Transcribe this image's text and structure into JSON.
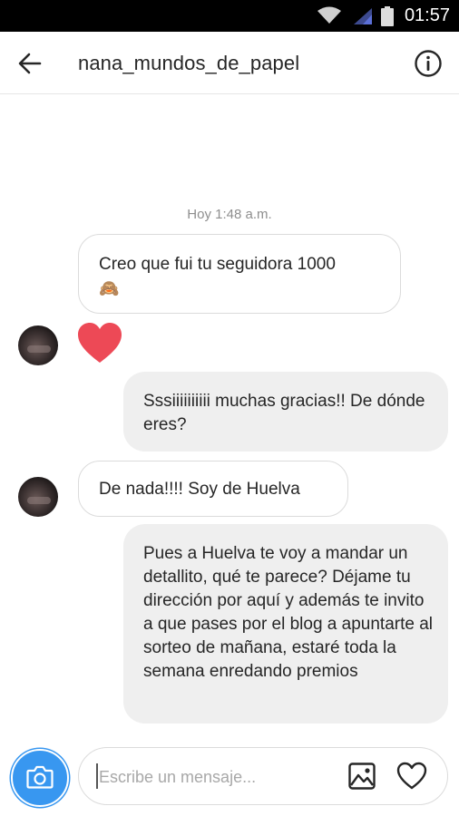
{
  "status_bar": {
    "time": "01:57"
  },
  "header": {
    "username": "nana_mundos_de_papel"
  },
  "thread": {
    "timestamp": "Hoy 1:48 a.m.",
    "messages": [
      {
        "from": "them",
        "text": "Creo que fui tu seguidora 1000",
        "emoji": "🙈"
      },
      {
        "from": "them",
        "type": "heart"
      },
      {
        "from": "me",
        "text": "Sssiiiiiiiiii muchas gracias!! De dónde eres?"
      },
      {
        "from": "them",
        "text": "De nada!!!! Soy de Huelva"
      },
      {
        "from": "me",
        "text": "Pues a Huelva te voy a mandar un detallito, qué te parece? Déjame tu dirección por aquí y además te invito a que pases por el blog a apuntarte al sorteo de mañana, estaré toda la semana enredando premios"
      }
    ]
  },
  "composer": {
    "placeholder": "Escribe un mensaje..."
  },
  "icons": {
    "back": "arrow-left-icon",
    "info": "info-icon",
    "camera": "camera-icon",
    "gallery": "image-icon",
    "like": "heart-icon"
  },
  "colors": {
    "accent": "#3897f0",
    "heart": "#ed4956",
    "bubble_out": "#efefef"
  }
}
